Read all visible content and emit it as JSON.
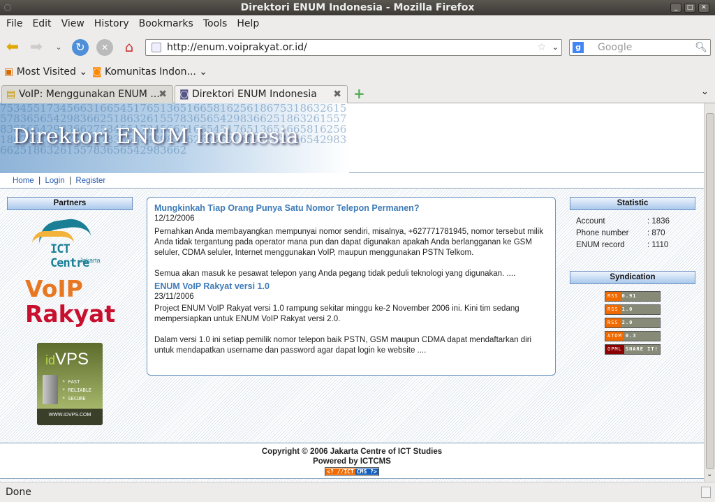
{
  "window": {
    "title": "Direktori ENUM Indonesia - Mozilla Firefox"
  },
  "menu": [
    "File",
    "Edit",
    "View",
    "History",
    "Bookmarks",
    "Tools",
    "Help"
  ],
  "url": "http://enum.voiprakyat.or.id/",
  "search_placeholder": "Google",
  "bookmarks": [
    "Most Visited",
    "Komunitas Indon..."
  ],
  "tabs": [
    {
      "label": "VoIP: Menggunakan ENUM ..."
    },
    {
      "label": "Direktori ENUM Indonesia"
    }
  ],
  "status": "Done",
  "page": {
    "banner_title": "Direktori ENUM Indonesia",
    "banner_digits": "7534551734566316654517651365166581625618675318632615578365654298366251863261557836565429836625186326155783656542983662",
    "links": [
      "Home",
      "Login",
      "Register"
    ],
    "partners": {
      "title": "Partners",
      "logos": [
        "ICT Centre",
        "Jakarta",
        "VoIP",
        "Rakyat",
        "id",
        "VPS",
        "* FAST",
        "* RELIABLE",
        "* SECURE",
        "WWW.IDVPS.COM"
      ]
    },
    "news": [
      {
        "title": "Mungkinkah Tiap Orang Punya Satu Nomor Telepon Permanen?",
        "date": "12/12/2006",
        "p1": "Pernahkan Anda membayangkan mempunyai nomor sendiri, misalnya, +627771781945, nomor tersebut milik Anda tidak tergantung pada operator mana pun dan dapat digunakan apakah Anda berlangganan ke GSM seluler, CDMA seluler, Internet menggunakan VoIP, maupun menggunakan PSTN Telkom.",
        "p2": "Semua akan masuk ke pesawat telepon yang Anda pegang tidak peduli teknologi yang digunakan. ...."
      },
      {
        "title": "ENUM VoIP Rakyat versi 1.0",
        "date": "23/11/2006",
        "p1": "Project ENUM VoIP Rakyat versi 1.0 rampung sekitar minggu ke-2 November 2006 ini. Kini tim sedang mempersiapkan untuk ENUM VoIP Rakyat versi 2.0.",
        "p2": "Dalam versi 1.0 ini setiap pemilik nomor telepon baik PSTN, GSM maupun CDMA dapat mendaftarkan diri untuk mendapatkan username dan password agar dapat login ke website ...."
      }
    ],
    "statistic": {
      "title": "Statistic",
      "rows": [
        {
          "label": "Account",
          "value": ": 1836"
        },
        {
          "label": "Phone number",
          "value": ": 870"
        },
        {
          "label": "ENUM record",
          "value": ": 1110"
        }
      ]
    },
    "syndication": {
      "title": "Syndication",
      "badges": [
        {
          "a": "RSS",
          "b": "0.91"
        },
        {
          "a": "RSS",
          "b": "1.0"
        },
        {
          "a": "RSS",
          "b": "2.0"
        },
        {
          "a": "ATOM",
          "b": "0.3"
        },
        {
          "a": "OPML",
          "b": "SHARE IT!"
        }
      ]
    },
    "footer": {
      "copyright": "Copyright © 2006 Jakarta Centre of ICT Studies",
      "powered": "Powered by ICTCMS",
      "badge_a": "<? //ICT",
      "badge_b": "CMS ?>"
    }
  }
}
